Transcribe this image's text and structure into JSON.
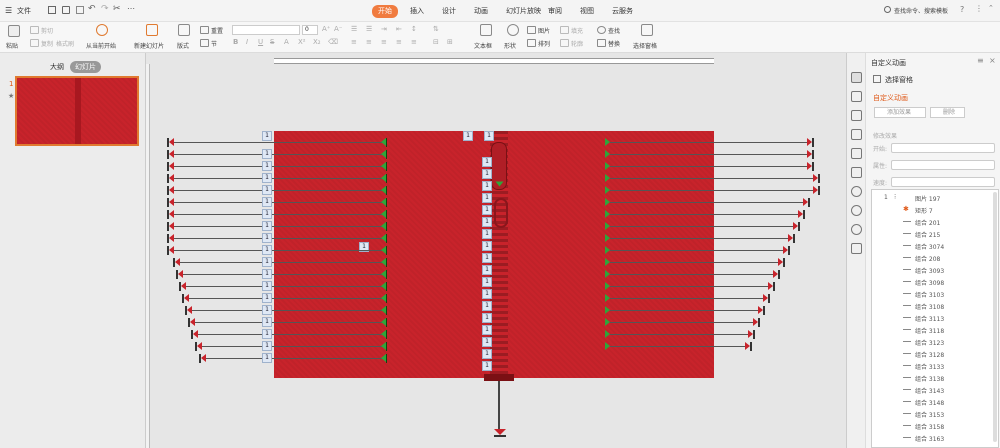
{
  "topbar": {
    "menu_label": "文件",
    "tabs": [
      "开始",
      "插入",
      "设计",
      "动画",
      "幻灯片放映",
      "审阅",
      "视图",
      "云服务"
    ],
    "active_tab": "开始",
    "search_text": "查找命令、搜索模板"
  },
  "ribbon": {
    "paste": "粘贴",
    "cut": "剪切",
    "copy": "复制",
    "format_painter": "格式刷",
    "from_current": "从当前开始",
    "new_slide": "新建幻灯片",
    "layout": "版式",
    "reset": "重置",
    "section": "节",
    "font_size": "0",
    "textbox": "文本框",
    "shape": "形状",
    "arrange": "排列",
    "picture": "图片",
    "fill": "填充",
    "outline": "轮廓",
    "find": "查找",
    "replace": "替换",
    "select_pane": "选择窗格"
  },
  "left_pane": {
    "tab_outline": "大纲",
    "tab_slides": "幻灯片",
    "slide_number": "1",
    "slide_star": "★"
  },
  "right_pane": {
    "title": "自定义动画",
    "select_pane": "选择窗格",
    "section_title": "自定义动画",
    "add_effect": "添加效果",
    "delete": "删除",
    "modify_effect": "修改效果",
    "start_label": "开始:",
    "property_label": "属性:",
    "speed_label": "速度:",
    "items": [
      {
        "num": "1",
        "name": "图片 197"
      },
      {
        "num": "",
        "name": "矩形 7"
      },
      {
        "num": "",
        "name": "组合 201"
      },
      {
        "num": "",
        "name": "组合 215"
      },
      {
        "num": "",
        "name": "组合 3074"
      },
      {
        "num": "",
        "name": "组合 208"
      },
      {
        "num": "",
        "name": "组合 3093"
      },
      {
        "num": "",
        "name": "组合 3098"
      },
      {
        "num": "",
        "name": "组合 3103"
      },
      {
        "num": "",
        "name": "组合 3108"
      },
      {
        "num": "",
        "name": "组合 3113"
      },
      {
        "num": "",
        "name": "组合 3118"
      },
      {
        "num": "",
        "name": "组合 3123"
      },
      {
        "num": "",
        "name": "组合 3128"
      },
      {
        "num": "",
        "name": "组合 3133"
      },
      {
        "num": "",
        "name": "组合 3138"
      },
      {
        "num": "",
        "name": "组合 3143"
      },
      {
        "num": "",
        "name": "组合 3148"
      },
      {
        "num": "",
        "name": "组合 3153"
      },
      {
        "num": "",
        "name": "组合 3158"
      },
      {
        "num": "",
        "name": "组合 3163"
      }
    ]
  },
  "slide": {
    "tag": "1",
    "colors": {
      "slide": "#c8232b",
      "start_marker": "#2fa53a",
      "end_marker": "#c8232b"
    }
  }
}
